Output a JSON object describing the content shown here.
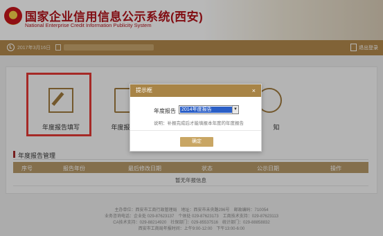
{
  "header": {
    "title": "国家企业信用信息公示系统(西安)",
    "subtitle": "National Enterprise Credit Information Publicity System"
  },
  "nav": {
    "date_text": "2017年3月16日",
    "logout_label": "退出登录"
  },
  "tiles": [
    {
      "label": "年度报告填写",
      "icon": "edit-report-icon"
    },
    {
      "label": "年度报告模",
      "icon": "report-template-icon"
    },
    {
      "label": "知",
      "icon": "notice-icon"
    }
  ],
  "section": {
    "title": "年度报告管理"
  },
  "table": {
    "headers": [
      "序号",
      "报告年份",
      "最后修改日期",
      "状态",
      "公示日期",
      "操作"
    ],
    "empty_text": "暂无年报信息"
  },
  "footer": {
    "lines": [
      "主办单位：西安市工商行政管理局　地址：西安市未央路296号　邮政编码：710054",
      "业务咨询电话：企业处 029-87623137　个体处 029-87623173　工商技术支持：029-87623113",
      "CA技术支持：029-88214920　社保部门：029-85537516　统计部门：029-88858832",
      "西安市工商局年报时间：上午9:00-12:00　下午13:00-6:00"
    ]
  },
  "dialog": {
    "title": "提示框",
    "close_label": "×",
    "year_label": "年度报告",
    "selected_year": "2014年度报告",
    "note": "说明：补报完成后才能填报本年度的年度报告",
    "confirm_label": "确定"
  },
  "colors": {
    "brand_red": "#b3121a",
    "nav_gold": "#b38a4d",
    "dialog_header": "#a88446",
    "highlight_red": "#e53935"
  }
}
